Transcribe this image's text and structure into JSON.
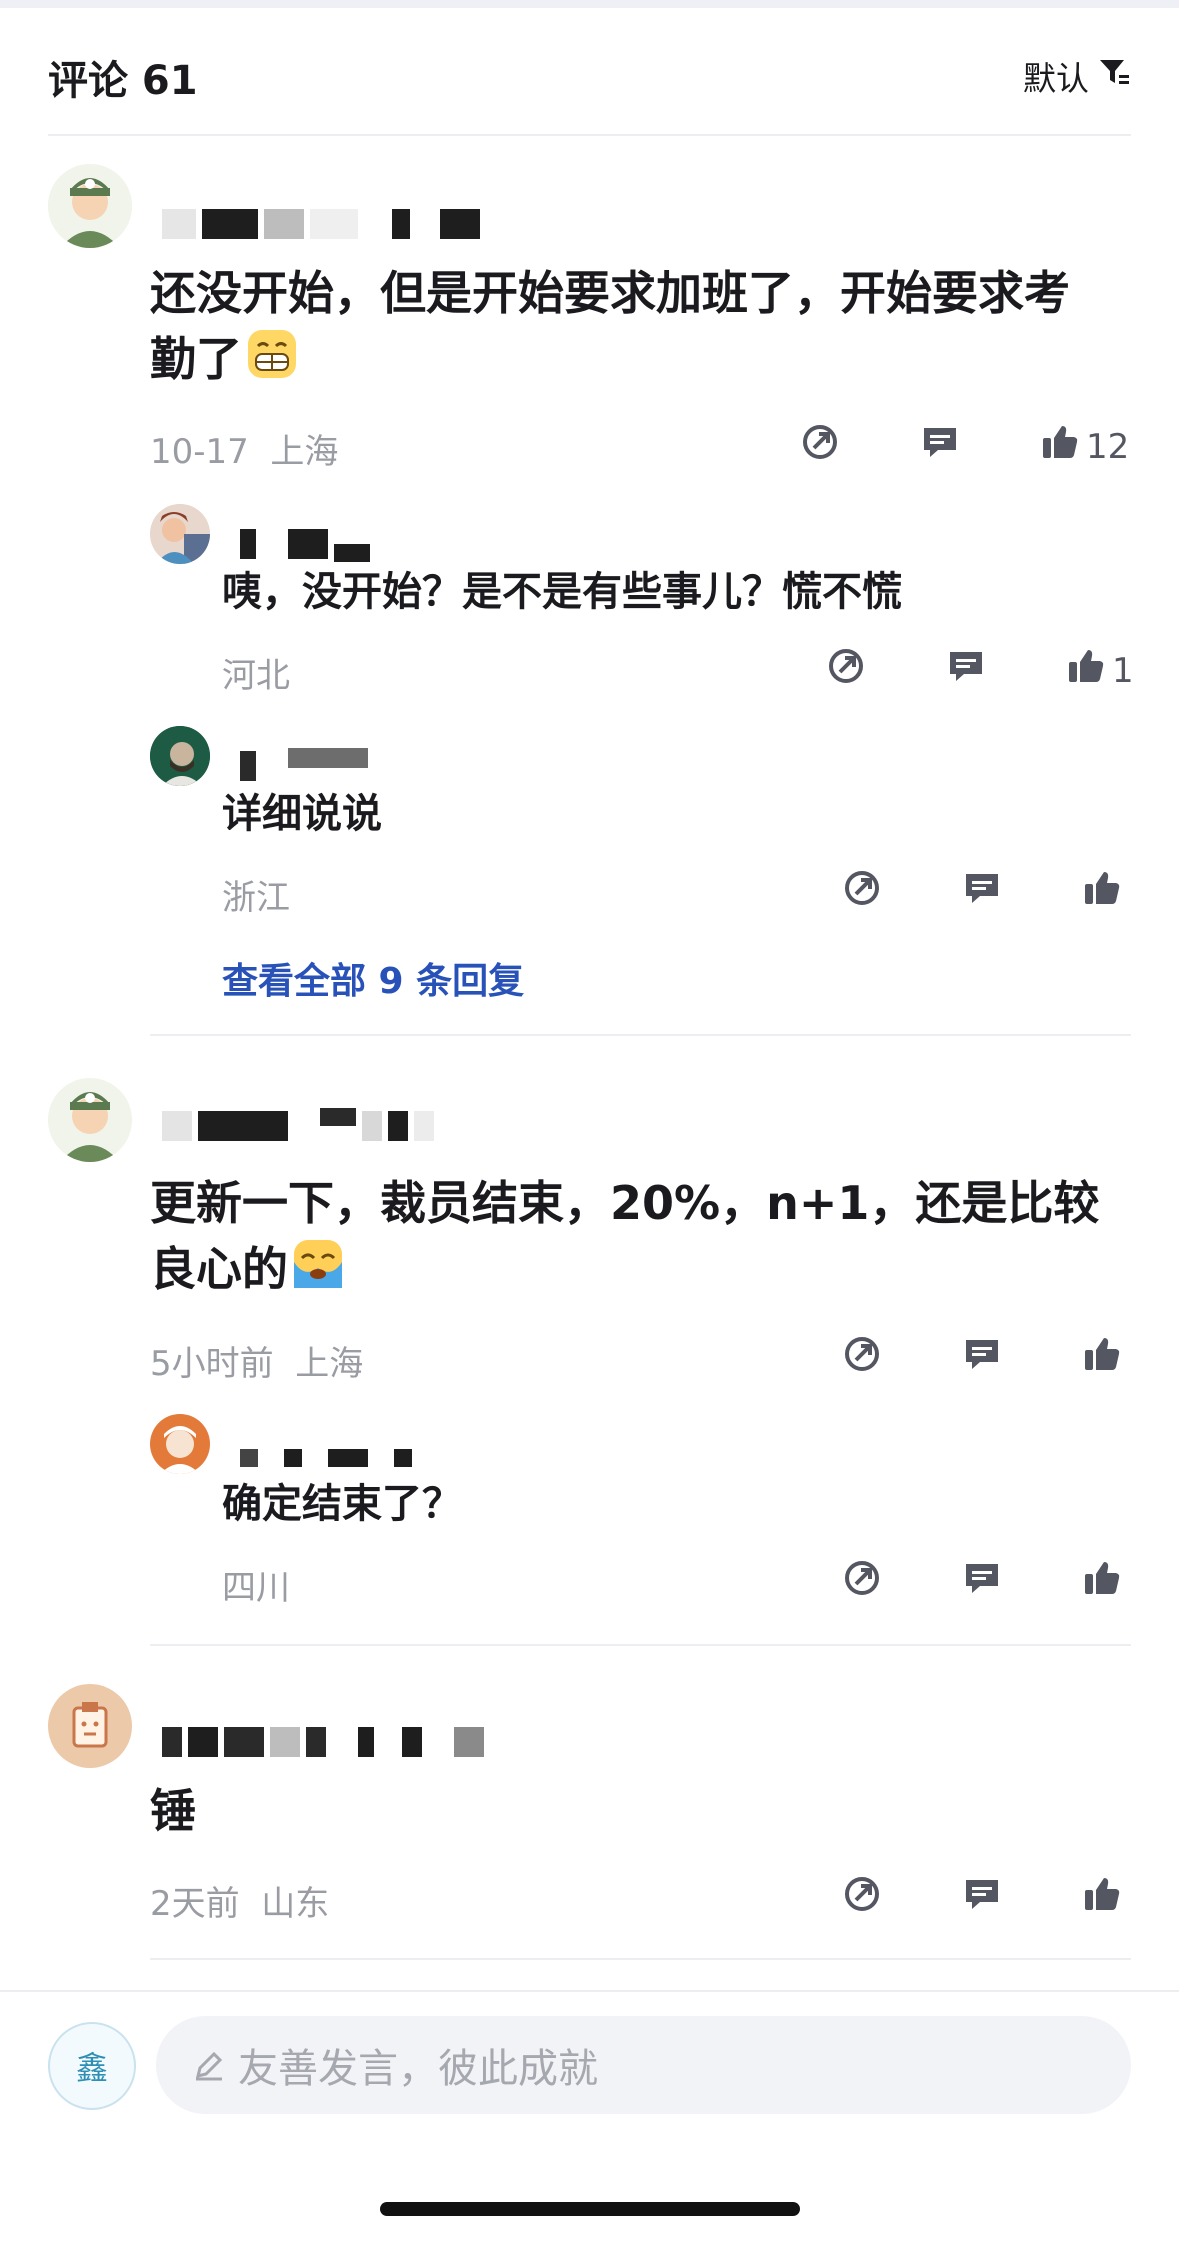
{
  "header": {
    "title": "评论 61",
    "sort_label": "默认"
  },
  "comments": [
    {
      "text_line1": "还没开始，但是开始要求加班了，开始要求考",
      "text_line2": "勤了",
      "date": "10-17",
      "location": "上海",
      "likes": "12",
      "replies": [
        {
          "text": "咦，没开始？是不是有些事儿？慌不慌",
          "location": "河北",
          "likes": "1"
        },
        {
          "text": "详细说说",
          "location": "浙江",
          "likes": ""
        }
      ],
      "view_all": "查看全部 9 条回复"
    },
    {
      "text_line1": "更新一下，裁员结束，20%，n+1，还是比较",
      "text_line2": "良心的",
      "date": "5小时前",
      "location": "上海",
      "likes": "",
      "replies": [
        {
          "text": "确定结束了？",
          "location": "四川",
          "likes": ""
        }
      ]
    },
    {
      "text_line1": "锤",
      "date": "2天前",
      "location": "山东",
      "likes": ""
    }
  ],
  "composer": {
    "avatar_char": "鑫",
    "placeholder": "友善发言，彼此成就"
  },
  "icons": {
    "sort": "filter-sort-icon",
    "share": "share-icon",
    "reply": "reply-bubble-icon",
    "like": "thumbs-up-icon",
    "pen": "pen-icon"
  }
}
